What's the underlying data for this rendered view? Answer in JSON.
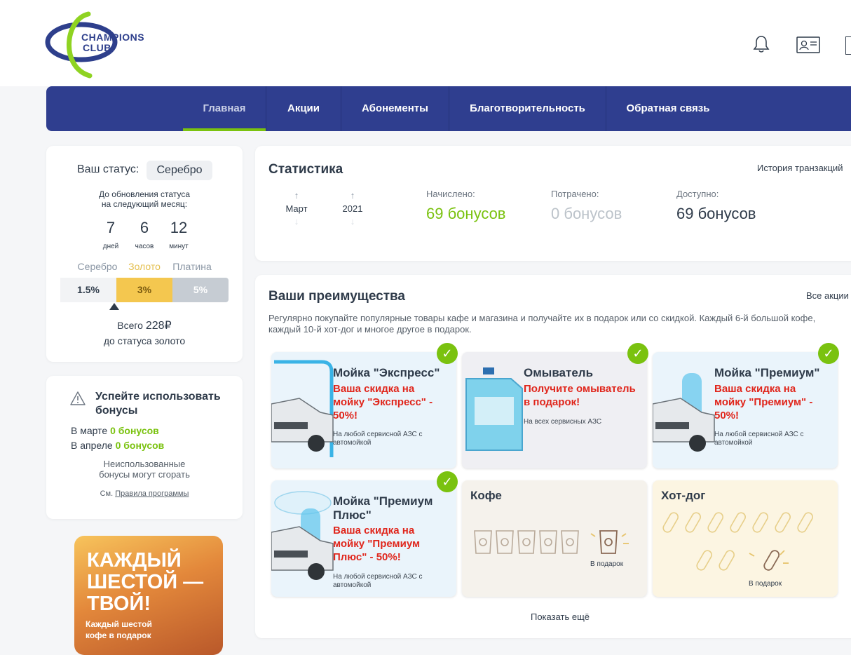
{
  "logo": {
    "line1": "CHAMPIONS",
    "line2": "CLUB"
  },
  "header": {
    "icons": [
      "bell-icon",
      "profile-card-icon"
    ]
  },
  "nav": {
    "items": [
      {
        "label": "Главная",
        "active": true
      },
      {
        "label": "Акции"
      },
      {
        "label": "Абонементы"
      },
      {
        "label": "Благотворительность"
      },
      {
        "label": "Обратная связь"
      }
    ]
  },
  "status": {
    "label": "Ваш статус:",
    "value": "Серебро",
    "note_line1": "До обновления статуса",
    "note_line2": "на следующий месяц:",
    "countdown": [
      {
        "value": "7",
        "unit": "дней"
      },
      {
        "value": "6",
        "unit": "часов"
      },
      {
        "value": "12",
        "unit": "минут"
      }
    ],
    "tiers": [
      {
        "name": "Серебро",
        "rate": "1.5%"
      },
      {
        "name": "Золото",
        "rate": "3%"
      },
      {
        "name": "Платина",
        "rate": "5%"
      }
    ],
    "total_prefix": "Всего",
    "total_value": "228₽",
    "total_suffix": "до статуса золото"
  },
  "warning": {
    "title_line1": "Успейте использовать",
    "title_line2": "бонусы",
    "march_label": "В марте",
    "march_value": "0 бонусов",
    "april_label": "В апреле",
    "april_value": "0 бонусов",
    "note_line1": "Неиспользованные",
    "note_line2": "бонусы могут сгорать",
    "rules_prefix": "См.",
    "rules_link": "Правила программы"
  },
  "promo": {
    "line1": "КАЖДЫЙ",
    "line2": "ШЕСТОЙ —",
    "line3": "ТВОЙ!",
    "small1": "Каждый шестой",
    "small2": "кофе в подарок"
  },
  "stats": {
    "title": "Статистика",
    "history_link": "История транзакций",
    "month": "Март",
    "year": "2021",
    "accrued_label": "Начислено:",
    "accrued_value": "69 бонусов",
    "spent_label": "Потрачено:",
    "spent_value": "0 бонусов",
    "available_label": "Доступно:",
    "available_value": "69 бонусов"
  },
  "advantages": {
    "title": "Ваши преимущества",
    "all_link": "Все акции",
    "desc": "Регулярно покупайте популярные товары кафе и магазина и получайте их в подарок или со скидкой. Каждый 6-й большой кофе, каждый 10-й хот-дог и многое другое в подарок.",
    "tiles": [
      {
        "title": "Мойка \"Экспресс\"",
        "offer": "Ваша скидка на мойку \"Экспресс\" - 50%!",
        "sub": "На любой сервисной АЗС с автомойкой"
      },
      {
        "title": "Омыватель",
        "offer": "Получите омыватель в подарок!",
        "sub": "На всех сервисных АЗС"
      },
      {
        "title": "Мойка \"Премиум\"",
        "offer": "Ваша скидка на мойку \"Премиум\" - 50%!",
        "sub": "На любой сервисной АЗС с автомойкой"
      },
      {
        "title": "Мойка \"Премиум Плюс\"",
        "offer": "Ваша скидка на мойку \"Премиум Плюс\" - 50%!",
        "sub": "На любой сервисной АЗС с автомойкой"
      },
      {
        "title": "Кофе",
        "gift": "В подарок"
      },
      {
        "title": "Хот-дог",
        "gift": "В подарок"
      }
    ],
    "show_more": "Показать ещё"
  },
  "colors": {
    "nav": "#2f3e8f",
    "accent_green": "#7ac20f",
    "offer_red": "#e0261c",
    "gold": "#f4c74f"
  }
}
